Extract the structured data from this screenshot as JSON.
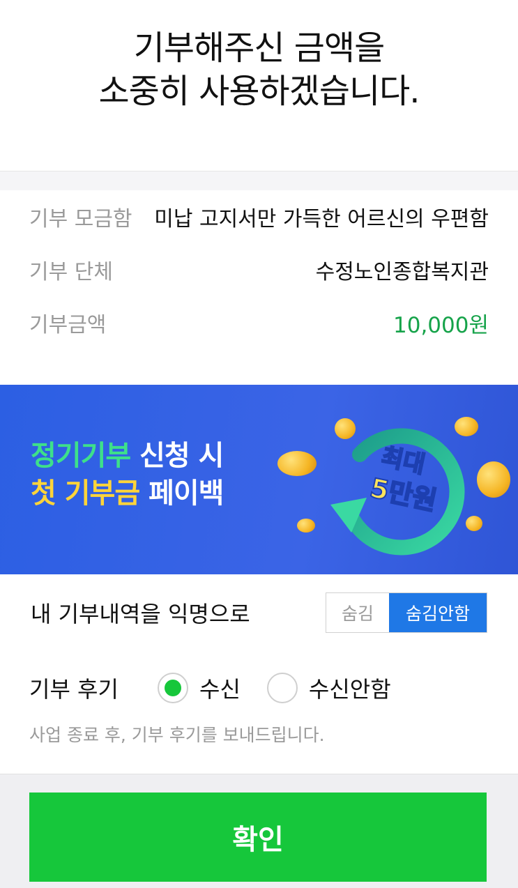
{
  "header": {
    "line1": "기부해주신 금액을",
    "line2": "소중히 사용하겠습니다."
  },
  "info": {
    "rows": [
      {
        "label": "기부 모금함",
        "value": "미납 고지서만 가득한 어르신의 우편함"
      },
      {
        "label": "기부 단체",
        "value": "수정노인종합복지관"
      },
      {
        "label": "기부금액",
        "value": "10,000원"
      }
    ]
  },
  "banner": {
    "line1_green": "정기기부",
    "line1_white": " 신청 시",
    "line2_yellow": "첫 기부금",
    "line2_white": " 페이백",
    "badge_top": "최대",
    "badge_bottom": "5만원"
  },
  "anonymous": {
    "label": "내 기부내역을 익명으로",
    "option_hide": "숨김",
    "option_show": "숨김안함",
    "selected": "숨김안함"
  },
  "review": {
    "label": "기부 후기",
    "option_receive": "수신",
    "option_decline": "수신안함",
    "selected": "수신",
    "note": "사업 종료 후, 기부 후기를 보내드립니다."
  },
  "footer": {
    "confirm_label": "확인"
  },
  "colors": {
    "accent_green": "#16c73b",
    "amount_green": "#16a34a",
    "toggle_blue": "#1f78e6",
    "banner_blue": "#3b64e6"
  }
}
